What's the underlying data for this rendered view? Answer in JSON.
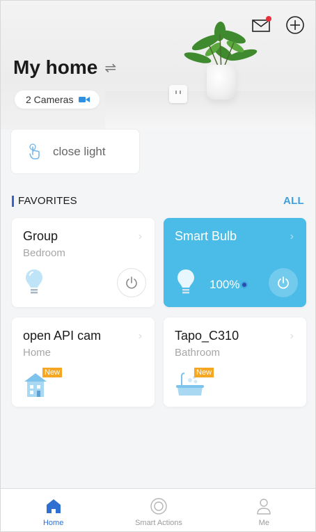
{
  "header": {
    "title": "My home",
    "swap_icon": "swap-icon",
    "cameras_label": "2 Cameras",
    "mail_badge_color": "#e8303d"
  },
  "scene": {
    "label": "close light",
    "icon": "tap-icon"
  },
  "favorites": {
    "title": "FAVORITES",
    "all_label": "ALL",
    "devices": [
      {
        "name": "Group",
        "room": "Bedroom",
        "icon": "bulb-icon",
        "power": "off"
      },
      {
        "name": "Smart Bulb",
        "room": "",
        "icon": "bulb-icon",
        "brightness": "100%",
        "power": "on",
        "color": "#4bbbe8"
      },
      {
        "name": "open API cam",
        "room": "Home",
        "icon": "house-thumb",
        "badge": "New"
      },
      {
        "name": "Tapo_C310",
        "room": "Bathroom",
        "icon": "bathroom-thumb",
        "badge": "New"
      }
    ]
  },
  "tabs": [
    {
      "label": "Home",
      "icon": "home-icon",
      "active": true
    },
    {
      "label": "Smart Actions",
      "icon": "smart-actions-icon",
      "active": false
    },
    {
      "label": "Me",
      "icon": "user-icon",
      "active": false
    }
  ],
  "colors": {
    "accent": "#3aa0e0",
    "active_tab": "#2f6fd1",
    "badge": "#f5a623"
  }
}
